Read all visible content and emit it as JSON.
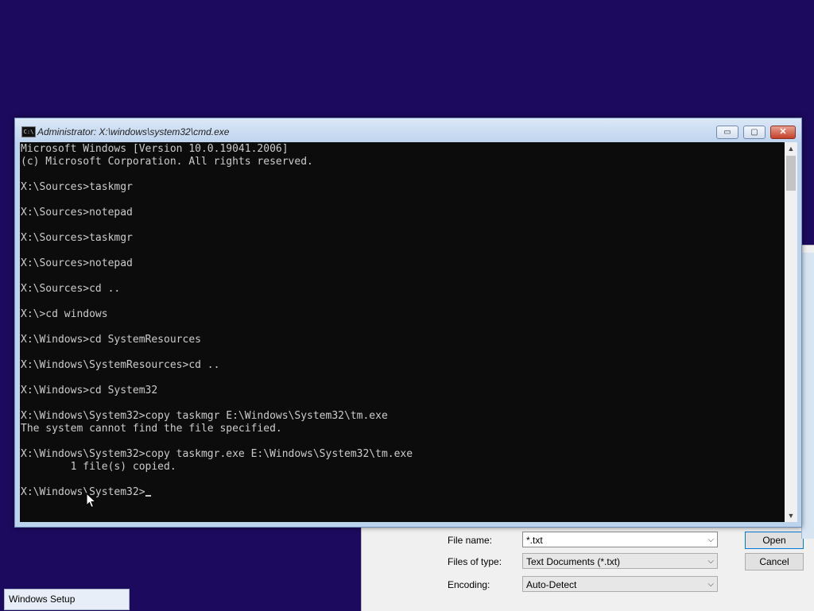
{
  "colors": {
    "desktop": "#1c0a5e",
    "console_bg": "#0c0c0c",
    "console_text": "#cccccc",
    "close_button": "#c4402a"
  },
  "cmd": {
    "title": "Administrator: X:\\windows\\system32\\cmd.exe",
    "icon": "console-icon",
    "buttons": {
      "minimize": "▭",
      "maximize": "▢",
      "close": "✕"
    },
    "output": "Microsoft Windows [Version 10.0.19041.2006]\n(c) Microsoft Corporation. All rights reserved.\n\nX:\\Sources>taskmgr\n\nX:\\Sources>notepad\n\nX:\\Sources>taskmgr\n\nX:\\Sources>notepad\n\nX:\\Sources>cd ..\n\nX:\\>cd windows\n\nX:\\Windows>cd SystemResources\n\nX:\\Windows\\SystemResources>cd ..\n\nX:\\Windows>cd System32\n\nX:\\Windows\\System32>copy taskmgr E:\\Windows\\System32\\tm.exe\nThe system cannot find the file specified.\n\nX:\\Windows\\System32>copy taskmgr.exe E:\\Windows\\System32\\tm.exe\n        1 file(s) copied.\n\n",
    "prompt": "X:\\Windows\\System32>"
  },
  "file_dialog": {
    "file_name_label": "File name:",
    "file_name_value": "*.txt",
    "files_of_type_label": "Files of type:",
    "files_of_type_value": "Text Documents (*.txt)",
    "encoding_label": "Encoding:",
    "encoding_value": "Auto-Detect",
    "open_label": "Open",
    "cancel_label": "Cancel"
  },
  "taskbar": {
    "windows_setup": "Windows Setup"
  }
}
